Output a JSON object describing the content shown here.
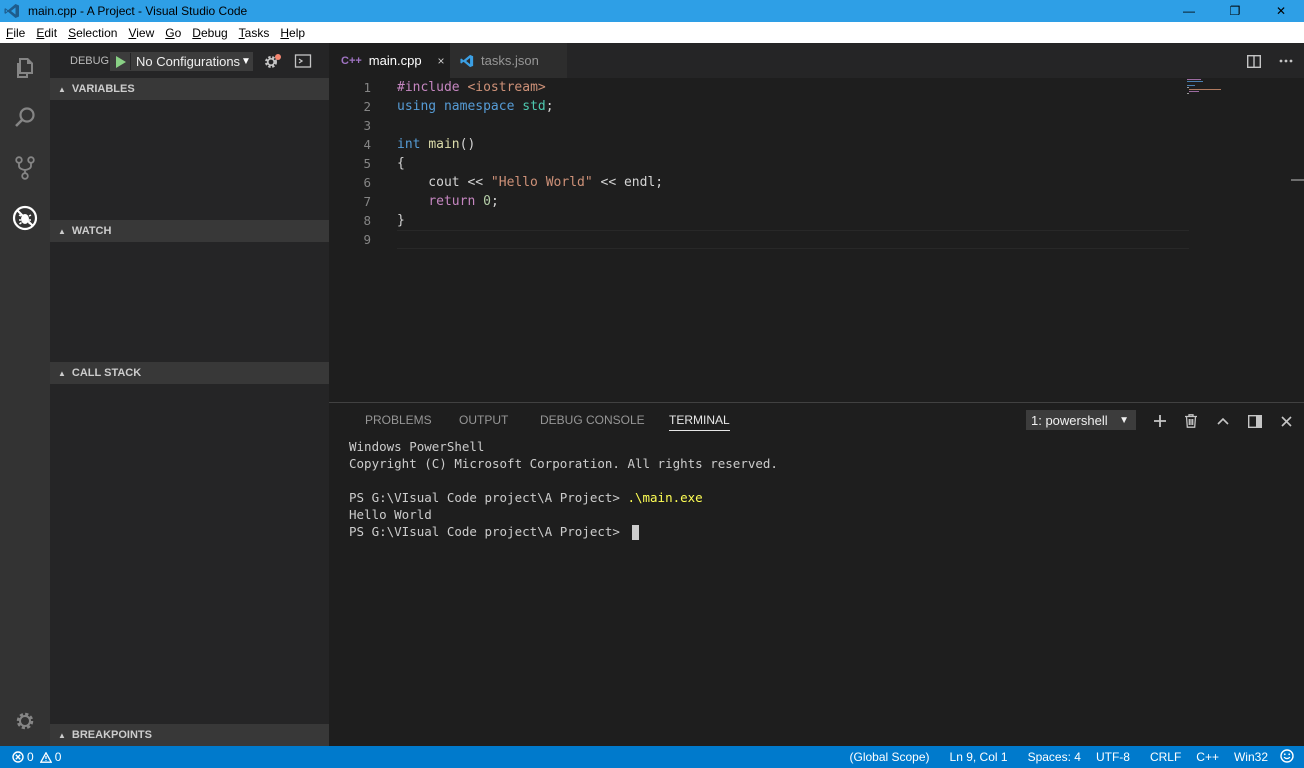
{
  "window": {
    "title": "main.cpp - A Project - Visual Studio Code",
    "minimize": "—",
    "maximize": "❐",
    "close": "✕"
  },
  "menu": [
    "File",
    "Edit",
    "Selection",
    "View",
    "Go",
    "Debug",
    "Tasks",
    "Help"
  ],
  "activity_bar": {
    "icons": [
      "explorer-icon",
      "search-icon",
      "source-control-icon",
      "debug-icon",
      "settings-gear-icon"
    ]
  },
  "debug": {
    "label": "DEBUG",
    "configuration": "No Configurations",
    "sections": {
      "variables": "VARIABLES",
      "watch": "WATCH",
      "call_stack": "CALL STACK",
      "breakpoints": "BREAKPOINTS"
    }
  },
  "tabs": [
    {
      "label": "main.cpp",
      "icon": "C++",
      "active": true,
      "close": "×"
    },
    {
      "label": "tasks.json",
      "icon": "vscode-icon",
      "active": false
    }
  ],
  "editor": {
    "line_numbers": [
      "1",
      "2",
      "3",
      "4",
      "5",
      "6",
      "7",
      "8",
      "9"
    ],
    "lines": [
      [
        {
          "t": "#include ",
          "c": "pre"
        },
        {
          "t": "<iostream>",
          "c": "inc"
        }
      ],
      [
        {
          "t": "using ",
          "c": "kw"
        },
        {
          "t": "namespace ",
          "c": "kw"
        },
        {
          "t": "std",
          "c": "ns"
        },
        {
          "t": ";",
          "c": ""
        }
      ],
      [],
      [
        {
          "t": "int ",
          "c": "kw"
        },
        {
          "t": "main",
          "c": "fn"
        },
        {
          "t": "()",
          "c": ""
        }
      ],
      [
        {
          "t": "{",
          "c": ""
        }
      ],
      [
        {
          "t": "    cout << ",
          "c": ""
        },
        {
          "t": "\"Hello World\"",
          "c": "str"
        },
        {
          "t": " << endl;",
          "c": ""
        }
      ],
      [
        {
          "t": "    ",
          "c": ""
        },
        {
          "t": "return ",
          "c": "ctl"
        },
        {
          "t": "0",
          "c": "num"
        },
        {
          "t": ";",
          "c": ""
        }
      ],
      [
        {
          "t": "}",
          "c": ""
        }
      ],
      []
    ]
  },
  "panel": {
    "tabs": [
      "PROBLEMS",
      "OUTPUT",
      "DEBUG CONSOLE",
      "TERMINAL"
    ],
    "active_tab": "TERMINAL",
    "terminal_select": "1: powershell",
    "terminal_lines": [
      {
        "text": "Windows PowerShell"
      },
      {
        "text": "Copyright (C) Microsoft Corporation. All rights reserved."
      },
      {
        "text": ""
      },
      {
        "text": "PS G:\\VIsual Code project\\A Project> ",
        "cmd": ".\\main.exe"
      },
      {
        "text": "Hello World"
      },
      {
        "text": "PS G:\\VIsual Code project\\A Project> ",
        "cursor": true
      }
    ]
  },
  "status": {
    "errors": "0",
    "warnings": "0",
    "scope": "(Global Scope)",
    "position": "Ln 9, Col 1",
    "spaces": "Spaces: 4",
    "encoding": "UTF-8",
    "eol": "CRLF",
    "language": "C++",
    "platform": "Win32"
  },
  "colors": {
    "titlebar": "#2e9fe6",
    "statusbar": "#007acc",
    "activitybar": "#333333",
    "sidebar": "#252526",
    "editor": "#1e1e1e"
  }
}
